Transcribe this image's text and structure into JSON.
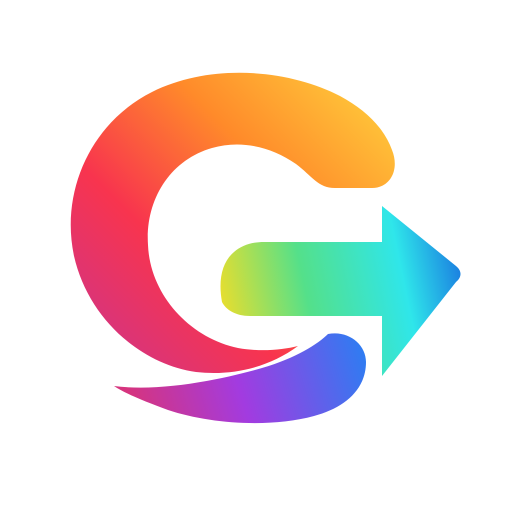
{
  "logo": {
    "icon": "g-arrow-logo-icon",
    "background_color": "#ffffff",
    "colors": {
      "orange": "#FF8A2A",
      "yellow": "#FFC83A",
      "red": "#F8344E",
      "magenta": "#D6347E",
      "purple": "#A23BE0",
      "blue": "#2D7DF2",
      "arrow_yellow": "#E8DE2E",
      "arrow_green": "#54E08A",
      "arrow_cyan": "#2FE6EA",
      "arrow_blue": "#1A7BE0"
    }
  }
}
